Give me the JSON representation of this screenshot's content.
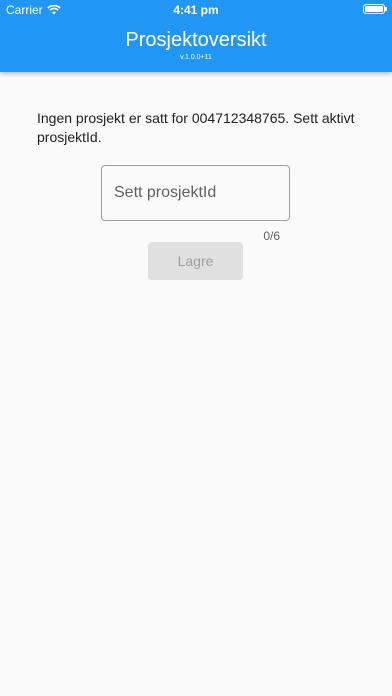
{
  "status_bar": {
    "carrier": "Carrier",
    "time": "4:41 pm",
    "icons": [
      "wifi-icon",
      "battery-icon"
    ]
  },
  "app_bar": {
    "title": "Prosjektoversikt",
    "version": "v.1.0.0+11",
    "color": "#2196f3"
  },
  "main": {
    "message": "Ingen prosjekt er satt for 004712348765. Sett aktivt prosjektId.",
    "project_field": {
      "placeholder": "Sett prosjektId",
      "value": ""
    },
    "counter": "0/6",
    "save_label": "Lagre"
  }
}
